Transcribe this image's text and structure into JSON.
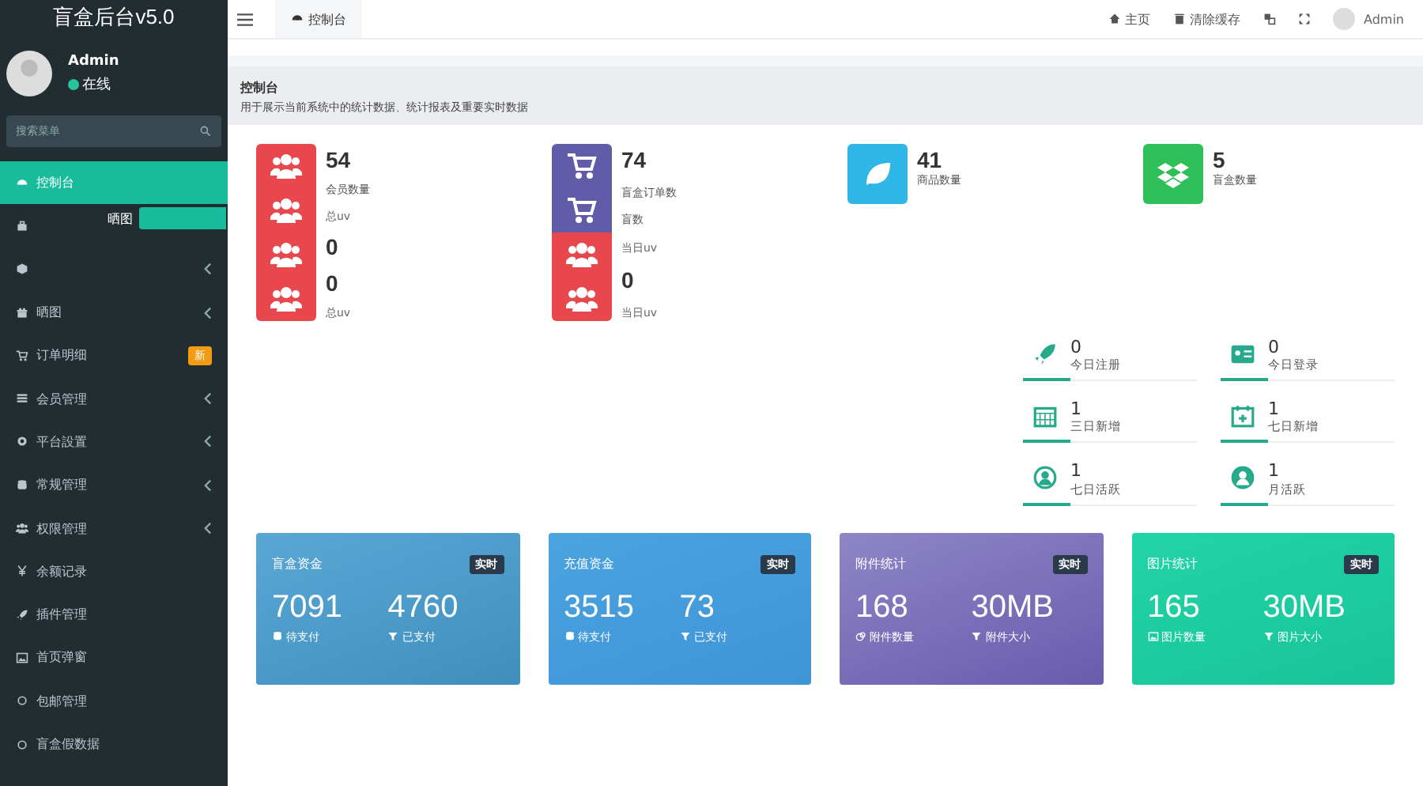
{
  "sidebar": {
    "logo": "盲盒后台v5.0",
    "user": {
      "name": "Admin",
      "status": "在线",
      "online": true
    },
    "search": {
      "placeholder": "搜索菜单"
    },
    "items": [
      {
        "label": "控制台",
        "selected": true,
        "arrow": false
      },
      {
        "selected": false,
        "arrow": false,
        "flyout": "晒图"
      },
      {
        "selected": false,
        "arrow": true
      },
      {
        "label": "晒图",
        "selected": false,
        "arrow": true
      },
      {
        "label": "订单明细",
        "selected": false,
        "arrow": false,
        "badge": "新"
      },
      {
        "label": "会员管理",
        "selected": false,
        "arrow": true
      },
      {
        "label": "平台設置",
        "selected": false,
        "arrow": true
      },
      {
        "label": "常规管理",
        "selected": false,
        "arrow": true
      },
      {
        "label": "权限管理",
        "selected": false,
        "arrow": true
      },
      {
        "label": "余额记录",
        "selected": false,
        "arrow": false
      },
      {
        "label": "插件管理",
        "selected": false,
        "arrow": false
      },
      {
        "label": "首页弹窗",
        "selected": false,
        "arrow": false
      },
      {
        "label": "包邮管理",
        "selected": false,
        "arrow": false
      },
      {
        "label": "盲盒假数据",
        "selected": false,
        "arrow": false
      }
    ]
  },
  "topbar": {
    "tabs": [
      {
        "label": "控制台",
        "selected": true
      }
    ],
    "links": [
      {
        "label": "主页"
      },
      {
        "label": "清除缓存"
      }
    ],
    "user": "Admin"
  },
  "header": {
    "title": "控制台",
    "description": "用于展示当前系统中的统计数据、统计报表及重要实时数据"
  },
  "stat_cards": [
    {
      "tiles": [
        {
          "color": "#e8474e"
        },
        {
          "color": "#e8474e"
        },
        {
          "color": "#e8474e"
        },
        {
          "color": "#e8474e"
        }
      ],
      "lines": [
        {
          "kind": "value",
          "text": "54"
        },
        {
          "kind": "label",
          "text": "会员数量"
        },
        {
          "kind": "small",
          "text": "总uv"
        },
        {
          "kind": "value",
          "text": "0"
        },
        {
          "kind": "value",
          "text": "0"
        },
        {
          "kind": "small",
          "text": "总uv"
        }
      ]
    },
    {
      "tiles": [
        {
          "color": "#605ca8"
        },
        {
          "color": "#605ca8"
        },
        {
          "color": "#e8474e"
        },
        {
          "color": "#e8474e"
        }
      ],
      "lines": [
        {
          "kind": "value",
          "text": "74"
        },
        {
          "kind": "label",
          "text": "盲盒订单数"
        },
        {
          "kind": "label",
          "text": "盲数"
        },
        {
          "kind": "small",
          "text": "当日uv"
        },
        {
          "kind": "value",
          "text": "0"
        },
        {
          "kind": "small",
          "text": "当日uv"
        }
      ]
    },
    {
      "tiles": [
        {
          "color": "#2eb6e6"
        }
      ],
      "lines": [
        {
          "kind": "value",
          "text": "41"
        },
        {
          "kind": "label",
          "text": "商品数量"
        }
      ]
    },
    {
      "tiles": [
        {
          "color": "#2fbf58"
        }
      ],
      "lines": [
        {
          "kind": "value",
          "text": "5"
        },
        {
          "kind": "label",
          "text": "盲盒数量"
        }
      ]
    }
  ],
  "mini_stats": [
    {
      "value": "0",
      "label": "今日注册"
    },
    {
      "value": "0",
      "label": "今日登录"
    },
    {
      "value": "1",
      "label": "三日新增"
    },
    {
      "value": "1",
      "label": "七日新增"
    },
    {
      "value": "1",
      "label": "七日活跃"
    },
    {
      "value": "1",
      "label": "月活跃"
    }
  ],
  "panels": [
    {
      "title": "盲盒资金",
      "badge": "实时",
      "items": [
        {
          "value": "7091",
          "label": "待支付"
        },
        {
          "value": "4760",
          "label": "已支付"
        }
      ]
    },
    {
      "title": "充值资金",
      "badge": "实时",
      "items": [
        {
          "value": "3515",
          "label": "待支付"
        },
        {
          "value": "73",
          "label": "已支付"
        }
      ]
    },
    {
      "title": "附件统计",
      "badge": "实时",
      "items": [
        {
          "value": "168",
          "label": "附件数量"
        },
        {
          "value": "30MB",
          "label": "附件大小"
        }
      ]
    },
    {
      "title": "图片统计",
      "badge": "实时",
      "items": [
        {
          "value": "165",
          "label": "图片数量"
        },
        {
          "value": "30MB",
          "label": "图片大小"
        }
      ]
    }
  ]
}
